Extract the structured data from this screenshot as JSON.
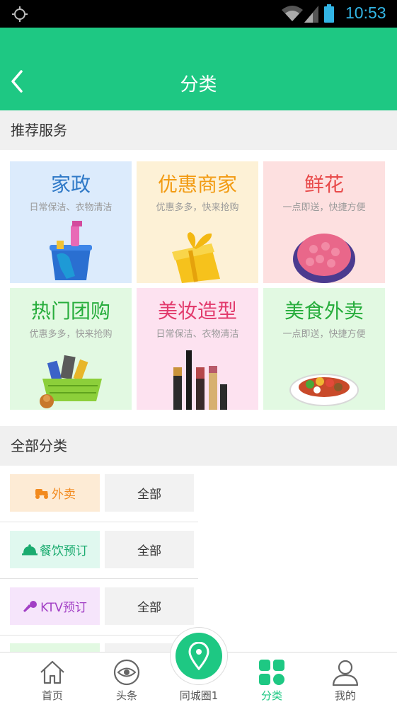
{
  "status_bar": {
    "time": "10:53"
  },
  "header": {
    "title": "分类"
  },
  "recommended": {
    "heading": "推荐服务",
    "tiles": [
      {
        "title": "家政",
        "subtitle": "日常保洁、衣物清洁",
        "bg": "#dcebfc",
        "color": "#2f79c7",
        "icon": "cleaning-supplies-icon"
      },
      {
        "title": "优惠商家",
        "subtitle": "优惠多多，快来抢购",
        "bg": "#fdf1d6",
        "color": "#f29b13",
        "icon": "gift-box-icon"
      },
      {
        "title": "鲜花",
        "subtitle": "一点即送，快捷方便",
        "bg": "#fde0e0",
        "color": "#e84a4a",
        "icon": "flower-bouquet-icon"
      },
      {
        "title": "热门团购",
        "subtitle": "优惠多多，快来抢购",
        "bg": "#e2f9e2",
        "color": "#27ad3c",
        "icon": "shopping-basket-icon"
      },
      {
        "title": "美妆造型",
        "subtitle": "日常保洁、衣物清洁",
        "bg": "#fde2f0",
        "color": "#e23a6c",
        "icon": "cosmetics-icon"
      },
      {
        "title": "美食外卖",
        "subtitle": "一点即送，快捷方便",
        "bg": "#e2f9e2",
        "color": "#27ad3c",
        "icon": "food-plate-icon"
      }
    ]
  },
  "all_categories": {
    "heading": "全部分类",
    "rows": [
      {
        "label": "外卖",
        "all_label": "全部",
        "bg": "#fdebd5",
        "color": "#f28a1e",
        "icon": "delivery-scooter-icon"
      },
      {
        "label": "餐饮预订",
        "all_label": "全部",
        "bg": "#e0f8ef",
        "color": "#1aab6f",
        "icon": "dining-cloche-icon"
      },
      {
        "label": "KTV预订",
        "all_label": "全部",
        "bg": "#f6e5fb",
        "color": "#a23fc5",
        "icon": "microphone-icon"
      }
    ]
  },
  "tab_bar": {
    "tabs": [
      {
        "label": "首页",
        "icon": "home-icon",
        "active": false
      },
      {
        "label": "头条",
        "icon": "eye-icon",
        "active": false
      },
      {
        "label": "同城圈1",
        "icon": "location-pin-icon",
        "active": false
      },
      {
        "label": "分类",
        "icon": "grid-categories-icon",
        "active": true
      },
      {
        "label": "我的",
        "icon": "user-icon",
        "active": false
      }
    ]
  },
  "colors": {
    "accent": "#1ec883"
  }
}
